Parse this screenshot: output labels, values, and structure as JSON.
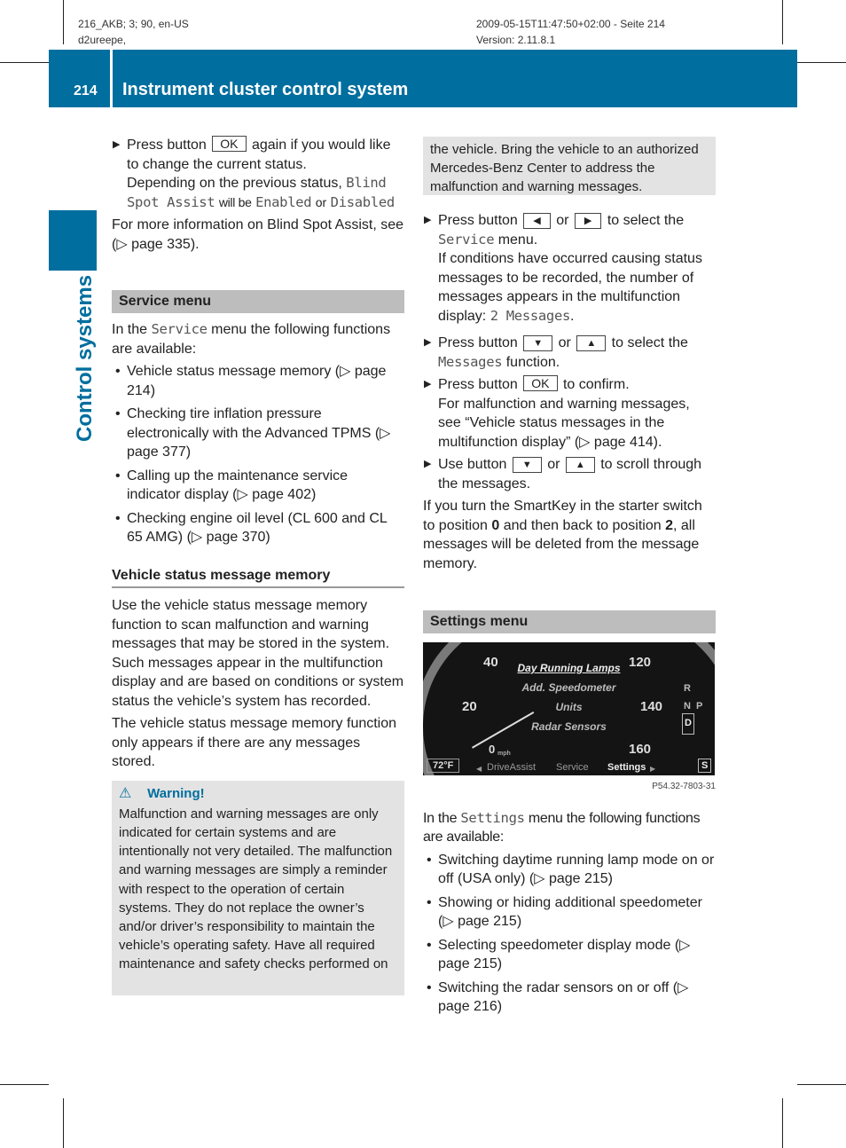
{
  "meta": {
    "left_line1": "216_AKB; 3; 90, en-US",
    "left_line2": "d2ureepe,",
    "right_line1": "2009-05-15T11:47:50+02:00 - Seite 214",
    "right_line2": "Version: 2.11.8.1"
  },
  "header": {
    "page_number": "214",
    "title": "Instrument cluster control system"
  },
  "side_label": "Control systems",
  "colors": {
    "brand_blue": "#006e9e",
    "section_gray": "#bdbdbd",
    "warning_bg": "#e3e3e3"
  },
  "left": {
    "step1": {
      "pre": "Press button",
      "key": "OK",
      "post": "again if you would like to change the current status.",
      "line2_pre": "Depending on the previous status,",
      "code1": "Blind Spot Assist",
      "mid": "will be",
      "code2": "Enabled",
      "or": "or",
      "code3": "Disabled"
    },
    "more_info": "For more information on Blind Spot Assist, see (▷ page 335).",
    "service_menu": {
      "heading": "Service menu",
      "intro_pre": "In the",
      "intro_code": "Service",
      "intro_post": "menu the following functions are available:",
      "bullets": [
        "Vehicle status message memory (▷ page 214)",
        "Checking tire inflation pressure electronically with the Advanced TPMS (▷ page 377)",
        "Calling up the maintenance service indicator display (▷ page 402)",
        "Checking engine oil level (CL 600 and CL 65 AMG) (▷ page 370)"
      ]
    },
    "vsmm": {
      "heading": "Vehicle status message memory",
      "para1": "Use the vehicle status message memory function to scan malfunction and warning messages that may be stored in the system. Such messages appear in the multifunction display and are based on conditions or system status the vehicle’s system has recorded.",
      "para2": "The vehicle status message memory function only appears if there are any messages stored."
    },
    "warning": {
      "icon": "warning-triangle-icon",
      "title": "Warning!",
      "text": "Malfunction and warning messages are only indicated for certain systems and are intentionally not very detailed. The malfunction and warning messages are simply a reminder with respect to the operation of certain systems. They do not replace the owner’s and/or driver’s responsibility to maintain the vehicle’s operating safety. Have all required maintenance and safety checks performed on"
    }
  },
  "right": {
    "warning_cont": "the vehicle. Bring the vehicle to an authorized Mercedes-Benz Center to address the malfunction and warning messages.",
    "step1": {
      "pre": "Press button",
      "key1": "◀",
      "or": "or",
      "key2": "▶",
      "post": "to select the",
      "code": "Service",
      "post2": "menu.",
      "line2": "If conditions have occurred causing status messages to be recorded, the number of messages appears in the multifunction display:",
      "code2": "2 Messages",
      "end": "."
    },
    "step2": {
      "pre": "Press button",
      "key1": "▼",
      "or": "or",
      "key2": "▲",
      "post": "to select the",
      "code": "Messages",
      "post2": "function."
    },
    "step3": {
      "pre": "Press button",
      "key": "OK",
      "post": "to confirm.",
      "line2": "For malfunction and warning messages, see “Vehicle status messages in the multifunction display” (▷ page 414)."
    },
    "step4": {
      "pre": "Use button",
      "key1": "▼",
      "or": "or",
      "key2": "▲",
      "post": "to scroll through the messages."
    },
    "smartkey": {
      "pre": "If you turn the SmartKey in the starter switch to position",
      "pos1": "0",
      "mid": "and then back to position",
      "pos2": "2",
      "post": ", all messages will be deleted from the message memory."
    },
    "settings_menu": {
      "heading": "Settings menu",
      "display": {
        "speed_left": [
          "40",
          "20",
          "0"
        ],
        "speed_right": [
          "120",
          "140",
          "160"
        ],
        "unit": "mph",
        "menu_items": [
          "Day Running Lamps",
          "Add. Speedometer",
          "Units",
          "Radar Sensors"
        ],
        "temp": "72°F",
        "nav": [
          "DriveAssist",
          "Service",
          "Settings"
        ],
        "gear": [
          "R",
          "N",
          "D"
        ],
        "park": "P",
        "s_badge": "S",
        "caption": "P54.32-7803-31"
      },
      "intro_pre": "In the",
      "intro_code": "Settings",
      "intro_post": "menu the following functions are available:",
      "bullets": [
        "Switching daytime running lamp mode on or off (USA only) (▷ page 215)",
        "Showing or hiding additional speedometer (▷ page 215)",
        "Selecting speedometer display mode (▷ page 215)",
        "Switching the radar sensors on or off (▷ page 216)"
      ]
    }
  }
}
